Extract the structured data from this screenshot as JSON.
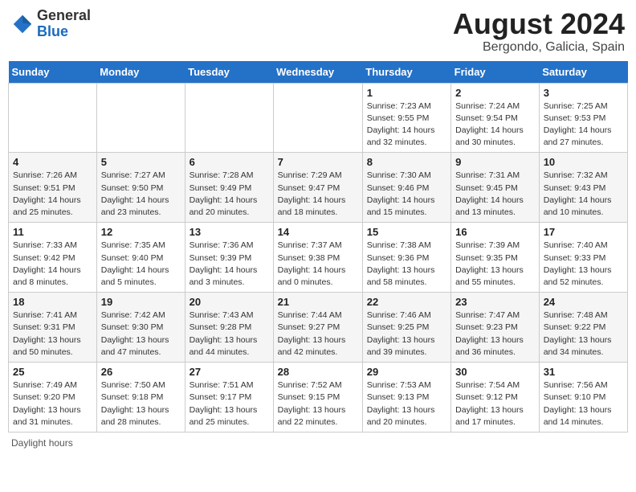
{
  "header": {
    "logo": {
      "general": "General",
      "blue": "Blue"
    },
    "title": "August 2024",
    "location": "Bergondo, Galicia, Spain"
  },
  "days_of_week": [
    "Sunday",
    "Monday",
    "Tuesday",
    "Wednesday",
    "Thursday",
    "Friday",
    "Saturday"
  ],
  "weeks": [
    [
      {
        "day": "",
        "info": ""
      },
      {
        "day": "",
        "info": ""
      },
      {
        "day": "",
        "info": ""
      },
      {
        "day": "",
        "info": ""
      },
      {
        "day": "1",
        "info": "Sunrise: 7:23 AM\nSunset: 9:55 PM\nDaylight: 14 hours\nand 32 minutes."
      },
      {
        "day": "2",
        "info": "Sunrise: 7:24 AM\nSunset: 9:54 PM\nDaylight: 14 hours\nand 30 minutes."
      },
      {
        "day": "3",
        "info": "Sunrise: 7:25 AM\nSunset: 9:53 PM\nDaylight: 14 hours\nand 27 minutes."
      }
    ],
    [
      {
        "day": "4",
        "info": "Sunrise: 7:26 AM\nSunset: 9:51 PM\nDaylight: 14 hours\nand 25 minutes."
      },
      {
        "day": "5",
        "info": "Sunrise: 7:27 AM\nSunset: 9:50 PM\nDaylight: 14 hours\nand 23 minutes."
      },
      {
        "day": "6",
        "info": "Sunrise: 7:28 AM\nSunset: 9:49 PM\nDaylight: 14 hours\nand 20 minutes."
      },
      {
        "day": "7",
        "info": "Sunrise: 7:29 AM\nSunset: 9:47 PM\nDaylight: 14 hours\nand 18 minutes."
      },
      {
        "day": "8",
        "info": "Sunrise: 7:30 AM\nSunset: 9:46 PM\nDaylight: 14 hours\nand 15 minutes."
      },
      {
        "day": "9",
        "info": "Sunrise: 7:31 AM\nSunset: 9:45 PM\nDaylight: 14 hours\nand 13 minutes."
      },
      {
        "day": "10",
        "info": "Sunrise: 7:32 AM\nSunset: 9:43 PM\nDaylight: 14 hours\nand 10 minutes."
      }
    ],
    [
      {
        "day": "11",
        "info": "Sunrise: 7:33 AM\nSunset: 9:42 PM\nDaylight: 14 hours\nand 8 minutes."
      },
      {
        "day": "12",
        "info": "Sunrise: 7:35 AM\nSunset: 9:40 PM\nDaylight: 14 hours\nand 5 minutes."
      },
      {
        "day": "13",
        "info": "Sunrise: 7:36 AM\nSunset: 9:39 PM\nDaylight: 14 hours\nand 3 minutes."
      },
      {
        "day": "14",
        "info": "Sunrise: 7:37 AM\nSunset: 9:38 PM\nDaylight: 14 hours\nand 0 minutes."
      },
      {
        "day": "15",
        "info": "Sunrise: 7:38 AM\nSunset: 9:36 PM\nDaylight: 13 hours\nand 58 minutes."
      },
      {
        "day": "16",
        "info": "Sunrise: 7:39 AM\nSunset: 9:35 PM\nDaylight: 13 hours\nand 55 minutes."
      },
      {
        "day": "17",
        "info": "Sunrise: 7:40 AM\nSunset: 9:33 PM\nDaylight: 13 hours\nand 52 minutes."
      }
    ],
    [
      {
        "day": "18",
        "info": "Sunrise: 7:41 AM\nSunset: 9:31 PM\nDaylight: 13 hours\nand 50 minutes."
      },
      {
        "day": "19",
        "info": "Sunrise: 7:42 AM\nSunset: 9:30 PM\nDaylight: 13 hours\nand 47 minutes."
      },
      {
        "day": "20",
        "info": "Sunrise: 7:43 AM\nSunset: 9:28 PM\nDaylight: 13 hours\nand 44 minutes."
      },
      {
        "day": "21",
        "info": "Sunrise: 7:44 AM\nSunset: 9:27 PM\nDaylight: 13 hours\nand 42 minutes."
      },
      {
        "day": "22",
        "info": "Sunrise: 7:46 AM\nSunset: 9:25 PM\nDaylight: 13 hours\nand 39 minutes."
      },
      {
        "day": "23",
        "info": "Sunrise: 7:47 AM\nSunset: 9:23 PM\nDaylight: 13 hours\nand 36 minutes."
      },
      {
        "day": "24",
        "info": "Sunrise: 7:48 AM\nSunset: 9:22 PM\nDaylight: 13 hours\nand 34 minutes."
      }
    ],
    [
      {
        "day": "25",
        "info": "Sunrise: 7:49 AM\nSunset: 9:20 PM\nDaylight: 13 hours\nand 31 minutes."
      },
      {
        "day": "26",
        "info": "Sunrise: 7:50 AM\nSunset: 9:18 PM\nDaylight: 13 hours\nand 28 minutes."
      },
      {
        "day": "27",
        "info": "Sunrise: 7:51 AM\nSunset: 9:17 PM\nDaylight: 13 hours\nand 25 minutes."
      },
      {
        "day": "28",
        "info": "Sunrise: 7:52 AM\nSunset: 9:15 PM\nDaylight: 13 hours\nand 22 minutes."
      },
      {
        "day": "29",
        "info": "Sunrise: 7:53 AM\nSunset: 9:13 PM\nDaylight: 13 hours\nand 20 minutes."
      },
      {
        "day": "30",
        "info": "Sunrise: 7:54 AM\nSunset: 9:12 PM\nDaylight: 13 hours\nand 17 minutes."
      },
      {
        "day": "31",
        "info": "Sunrise: 7:56 AM\nSunset: 9:10 PM\nDaylight: 13 hours\nand 14 minutes."
      }
    ]
  ],
  "footer": {
    "label": "Daylight hours"
  }
}
